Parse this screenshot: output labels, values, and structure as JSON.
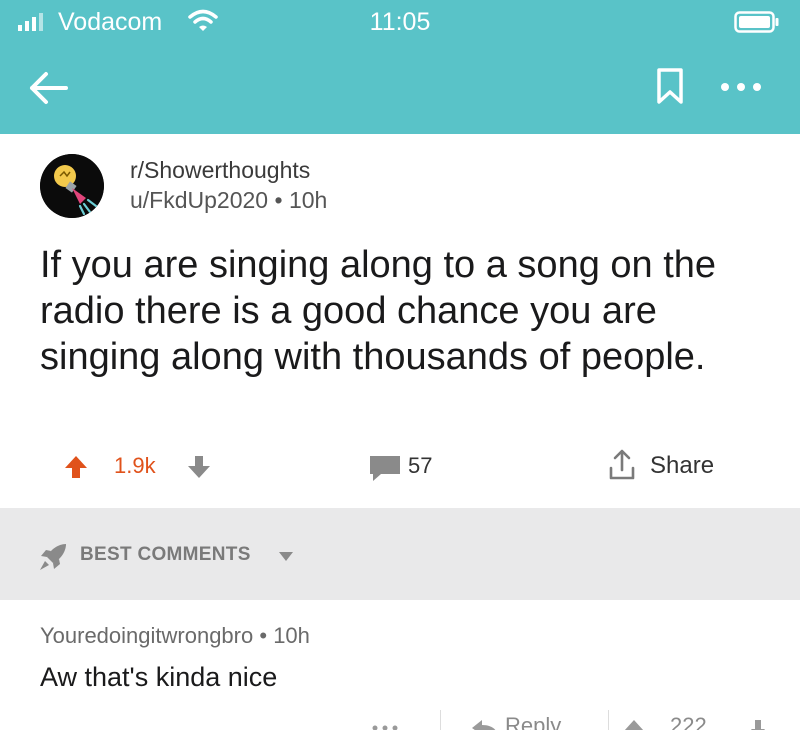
{
  "status_bar": {
    "carrier": "Vodacom",
    "time": "11:05",
    "icons": [
      "signal-icon",
      "wifi-icon",
      "battery-icon"
    ]
  },
  "nav": {
    "icons": [
      "back-arrow-icon",
      "bookmark-icon",
      "more-options-icon"
    ]
  },
  "post": {
    "subreddit": "r/Showerthoughts",
    "author": "u/FkdUp2020",
    "separator": "•",
    "age": "10h",
    "avatar_icon": "lightbulb-shower-icon",
    "title": "If you are singing along to a song on the radio there is a good chance you are singing along with thousands of people.",
    "score": "1.9k",
    "comment_count": "57",
    "share_label": "Share"
  },
  "comments_section": {
    "sort_label": "BEST COMMENTS",
    "sort_icon": "rocket-icon"
  },
  "comments": [
    {
      "author": "Youredoingitwrongbro",
      "separator": "•",
      "age": "10h",
      "body": "Aw that's kinda nice",
      "reply_label": "Reply",
      "score": "222"
    }
  ],
  "colors": {
    "header": "#59c3c8",
    "upvote_active": "#e0521b",
    "sort_bar": "#e9e9ea"
  }
}
